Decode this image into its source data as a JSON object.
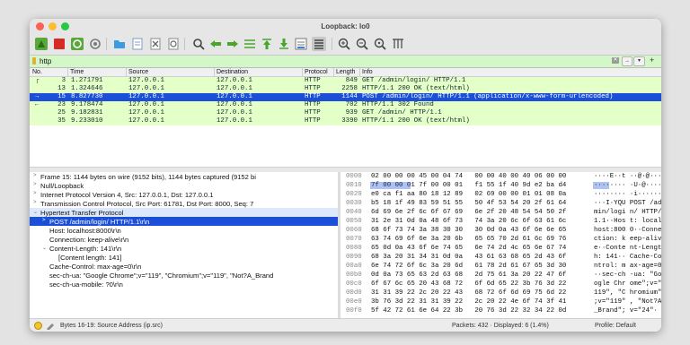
{
  "window": {
    "title": "Loopback: lo0"
  },
  "filter": {
    "text": "http"
  },
  "packet_list": {
    "columns": [
      "No.",
      "Time",
      "Source",
      "Destination",
      "Protocol",
      "Length",
      "Info"
    ],
    "rows": [
      {
        "no": "3",
        "time": "1.271791",
        "src": "127.0.0.1",
        "dst": "127.0.0.1",
        "proto": "HTTP",
        "len": "849",
        "info": "GET /admin/login/ HTTP/1.1",
        "bg": "#e4ffc7",
        "fg": "#12272e",
        "arrow": "┌"
      },
      {
        "no": "13",
        "time": "1.324646",
        "src": "127.0.0.1",
        "dst": "127.0.0.1",
        "proto": "HTTP",
        "len": "2258",
        "info": "HTTP/1.1 200 OK  (text/html)",
        "bg": "#e4ffc7",
        "fg": "#12272e",
        "arrow": ""
      },
      {
        "no": "15",
        "time": "8.827730",
        "src": "127.0.0.1",
        "dst": "127.0.0.1",
        "proto": "HTTP",
        "len": "1144",
        "info": "POST /admin/login/ HTTP/1.1  (application/x-www-form-urlencoded)",
        "bg": "#1b4fd8",
        "fg": "#ffffff",
        "arrow": "→"
      },
      {
        "no": "23",
        "time": "9.178474",
        "src": "127.0.0.1",
        "dst": "127.0.0.1",
        "proto": "HTTP",
        "len": "702",
        "info": "HTTP/1.1 302 Found",
        "bg": "#e4ffc7",
        "fg": "#12272e",
        "arrow": "←"
      },
      {
        "no": "25",
        "time": "9.182831",
        "src": "127.0.0.1",
        "dst": "127.0.0.1",
        "proto": "HTTP",
        "len": "939",
        "info": "GET /admin/ HTTP/1.1",
        "bg": "#e4ffc7",
        "fg": "#12272e",
        "arrow": ""
      },
      {
        "no": "35",
        "time": "9.233010",
        "src": "127.0.0.1",
        "dst": "127.0.0.1",
        "proto": "HTTP",
        "len": "3390",
        "info": "HTTP/1.1 200 OK  (text/html)",
        "bg": "#e4ffc7",
        "fg": "#12272e",
        "arrow": ""
      }
    ]
  },
  "details": [
    {
      "tw": ">",
      "text": "Frame 15: 1144 bytes on wire (9152 bits), 1144 bytes captured (9152 bi",
      "indent": 0,
      "style": "normal"
    },
    {
      "tw": ">",
      "text": "Null/Loopback",
      "indent": 0,
      "style": "normal"
    },
    {
      "tw": ">",
      "text": "Internet Protocol Version 4, Src: 127.0.0.1, Dst: 127.0.0.1",
      "indent": 0,
      "style": "normal"
    },
    {
      "tw": ">",
      "text": "Transmission Control Protocol, Src Port: 61781, Dst Port: 8000, Seq: 7",
      "indent": 0,
      "style": "normal"
    },
    {
      "tw": "⌄",
      "text": "Hypertext Transfer Protocol",
      "indent": 0,
      "style": "header"
    },
    {
      "tw": ">",
      "text": "POST /admin/login/ HTTP/1.1\\r\\n",
      "indent": 1,
      "style": "highlight"
    },
    {
      "tw": "",
      "text": "Host: localhost:8000\\r\\n",
      "indent": 1,
      "style": "normal"
    },
    {
      "tw": "",
      "text": "Connection: keep-alive\\r\\n",
      "indent": 1,
      "style": "normal"
    },
    {
      "tw": "⌄",
      "text": "Content-Length: 141\\r\\n",
      "indent": 1,
      "style": "normal"
    },
    {
      "tw": "",
      "text": "[Content length: 141]",
      "indent": 2,
      "style": "normal"
    },
    {
      "tw": "",
      "text": "Cache-Control: max-age=0\\r\\n",
      "indent": 1,
      "style": "normal"
    },
    {
      "tw": "",
      "text": "sec-ch-ua: \"Google Chrome\";v=\"119\", \"Chromium\";v=\"119\", \"Not?A_Brand",
      "indent": 1,
      "style": "normal"
    },
    {
      "tw": "",
      "text": "sec-ch-ua-mobile: ?0\\r\\n",
      "indent": 1,
      "style": "normal"
    }
  ],
  "hex": [
    {
      "off": "0000",
      "hex": "02 00 00 00 45 00 04 74   00 00 40 00 40 06 00 00",
      "ascii": "····E··t ··@·@···"
    },
    {
      "off": "0010",
      "hex": "7f 00 00 01 7f 00 00 01   f1 55 1f 40 9d e2 ba d4",
      "ascii": "········ ·U·@····"
    },
    {
      "off": "0020",
      "hex": "e0 ca f1 aa 80 18 12 89   02 69 00 00 01 01 08 0a",
      "ascii": "········ ·i······"
    },
    {
      "off": "0030",
      "hex": "b5 18 1f 49 83 59 51 55   50 4f 53 54 20 2f 61 64",
      "ascii": "···I·YQU POST /ad"
    },
    {
      "off": "0040",
      "hex": "6d 69 6e 2f 6c 6f 67 69   6e 2f 20 48 54 54 50 2f",
      "ascii": "min/logi n/ HTTP/"
    },
    {
      "off": "0050",
      "hex": "31 2e 31 0d 0a 48 6f 73   74 3a 20 6c 6f 63 61 6c",
      "ascii": "1.1··Hos t: local"
    },
    {
      "off": "0060",
      "hex": "68 6f 73 74 3a 38 30 30   30 0d 0a 43 6f 6e 6e 65",
      "ascii": "host:800 0··Conne"
    },
    {
      "off": "0070",
      "hex": "63 74 69 6f 6e 3a 20 6b   65 65 70 2d 61 6c 69 76",
      "ascii": "ction: k eep-aliv"
    },
    {
      "off": "0080",
      "hex": "65 0d 0a 43 6f 6e 74 65   6e 74 2d 4c 65 6e 67 74",
      "ascii": "e··Conte nt-Lengt"
    },
    {
      "off": "0090",
      "hex": "68 3a 20 31 34 31 0d 0a   43 61 63 68 65 2d 43 6f",
      "ascii": "h: 141·· Cache-Co"
    },
    {
      "off": "00a0",
      "hex": "6e 74 72 6f 6c 3a 20 6d   61 78 2d 61 67 65 3d 30",
      "ascii": "ntrol: m ax-age=0"
    },
    {
      "off": "00b0",
      "hex": "0d 0a 73 65 63 2d 63 68   2d 75 61 3a 20 22 47 6f",
      "ascii": "··sec-ch -ua: \"Go"
    },
    {
      "off": "00c0",
      "hex": "6f 67 6c 65 20 43 68 72   6f 6d 65 22 3b 76 3d 22",
      "ascii": "ogle Chr ome\";v=\""
    },
    {
      "off": "00d0",
      "hex": "31 31 39 22 2c 20 22 43   68 72 6f 6d 69 75 6d 22",
      "ascii": "119\", \"C hromium\""
    },
    {
      "off": "00e0",
      "hex": "3b 76 3d 22 31 31 39 22   2c 20 22 4e 6f 74 3f 41",
      "ascii": ";v=\"119\" , \"Not?A"
    },
    {
      "off": "00f0",
      "hex": "5f 42 72 61 6e 64 22 3b   20 76 3d 22 32 34 22 0d",
      "ascii": "_Brand\"; v=\"24\"·"
    }
  ],
  "status": {
    "field": "Bytes 16-19: Source Address (ip.src)",
    "packets": "Packets: 432 · Displayed: 6 (1.4%)",
    "profile": "Profile: Default"
  },
  "colors": {
    "selected": "#1b4fd8",
    "http_row": "#e4ffc7",
    "highlight_bytes": "#1b4fd8",
    "filter_ok": "#d4f7c8"
  },
  "toolbar_icons": [
    "shark-fin-start-icon",
    "stop-icon",
    "restart-icon",
    "options-gear-icon",
    "open-folder-icon",
    "save-file-icon",
    "close-file-icon",
    "reload-icon",
    "find-icon",
    "go-back-icon",
    "go-forward-icon",
    "go-to-packet-icon",
    "go-first-icon",
    "go-last-icon",
    "autoscroll-icon",
    "colorize-icon",
    "zoom-in-icon",
    "zoom-out-icon",
    "zoom-normal-icon",
    "resize-columns-icon"
  ]
}
